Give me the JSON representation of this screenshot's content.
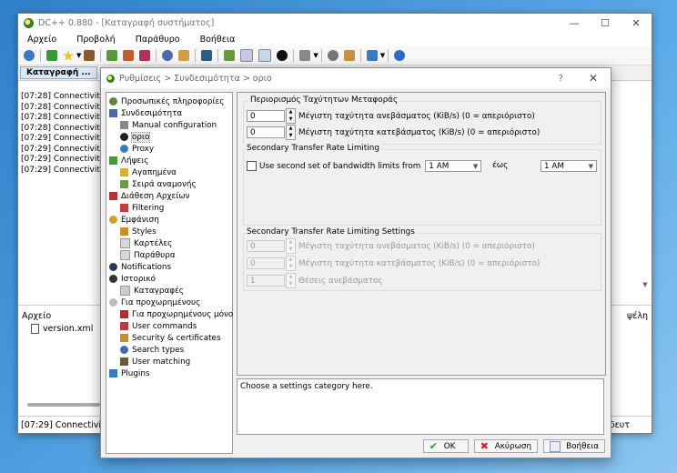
{
  "main": {
    "title": "DC++ 0.880 - [Καταγραφή συστήματος]",
    "menu": [
      "Αρχείο",
      "Προβολή",
      "Παράθυρο",
      "Βοήθεια"
    ],
    "tab": "Καταγραφή ...",
    "log": [
      "[07:28] Connectivity",
      "[07:28] Connectivity",
      "[07:28] Connectivity",
      "[07:28] Connectivity",
      "[07:29] Connectivity",
      "[07:29] Connectivity",
      "[07:29] Connectivity",
      "[07:29] Connectivity"
    ],
    "lower_header": "Αρχείο",
    "lower_header_right": "ψέλη",
    "lower_file": "version.xml",
    "status_left": "[07:29] Connectivity",
    "status_right": "δευτ"
  },
  "dialog": {
    "title": "Ρυθμίσεις > Συνδεσιμότητα > οριο",
    "help_button": "?",
    "tree": [
      {
        "label": "Προσωπικές πληροφορίες",
        "icon": "person-icon"
      },
      {
        "label": "Συνδεσιμότητα",
        "icon": "network-icon"
      },
      {
        "label": "Manual configuration",
        "icon": "wrench-icon"
      },
      {
        "label": "οριο",
        "icon": "limit-icon"
      },
      {
        "label": "Proxy",
        "icon": "globe-icon"
      },
      {
        "label": "Λήψεις",
        "icon": "download-icon"
      },
      {
        "label": "Αγαπημένα",
        "icon": "star-icon"
      },
      {
        "label": "Σειρά αναμονής",
        "icon": "queue-icon"
      },
      {
        "label": "Διάθεση Αρχείων",
        "icon": "share-icon"
      },
      {
        "label": "Filtering",
        "icon": "filter-icon"
      },
      {
        "label": "Εμφάνιση",
        "icon": "appearance-icon"
      },
      {
        "label": "Styles",
        "icon": "palette-icon"
      },
      {
        "label": "Καρτέλες",
        "icon": "tabs-icon"
      },
      {
        "label": "Παράθυρα",
        "icon": "window-icon"
      },
      {
        "label": "Notifications",
        "icon": "bell-icon"
      },
      {
        "label": "Ιστορικό",
        "icon": "history-icon"
      },
      {
        "label": "Καταγραφές",
        "icon": "log-icon"
      },
      {
        "label": "Για προχωρημένους",
        "icon": "advanced-icon"
      },
      {
        "label": "Για προχωρημένους μόνο",
        "icon": "tools-icon"
      },
      {
        "label": "User commands",
        "icon": "command-icon"
      },
      {
        "label": "Security & certificates",
        "icon": "lock-icon"
      },
      {
        "label": "Search types",
        "icon": "search-icon"
      },
      {
        "label": "User matching",
        "icon": "users-icon"
      },
      {
        "label": "Plugins",
        "icon": "plugin-icon"
      }
    ],
    "selected": "οριο",
    "transfer_limits": {
      "title": "Περιορισμός Ταχύτητων Μεταφοράς",
      "upload_value": "0",
      "upload_label": "Μέγιστη ταχύτητα ανεβάσματος (KiB/s) (0 = απεριόριστο)",
      "download_value": "0",
      "download_label": "Μέγιστη ταχύτητα κατεβάσματος (KiB/s) (0 = απεριόριστο)"
    },
    "secondary": {
      "title": "Secondary Transfer Rate Limiting",
      "checkbox_label": "Use second set of bandwidth limits from",
      "from_value": "1 AM",
      "to_label": "έως",
      "to_value": "1 AM"
    },
    "secondary_settings": {
      "title": "Secondary Transfer Rate Limiting Settings",
      "upload_value": "0",
      "upload_label": "Μέγιστη ταχύτητα ανεβάσματος (KiB/s) (0 = απεριόριστο)",
      "download_value": "0",
      "download_label": "Μέγιστη ταχύτητα κατεβάσματος (KiB/s) (0 = απεριόριστο)",
      "slots_value": "1",
      "slots_label": "Θέσεις ανεβάσματος"
    },
    "help_text": "Choose a settings category here.",
    "buttons": {
      "ok": "OK",
      "cancel": "Ακύρωση",
      "help": "Βοήθεια"
    }
  },
  "colors": {
    "accent": "#1e6fc7",
    "ok_green": "#2e9a2e",
    "cancel_red": "#cc2222"
  }
}
